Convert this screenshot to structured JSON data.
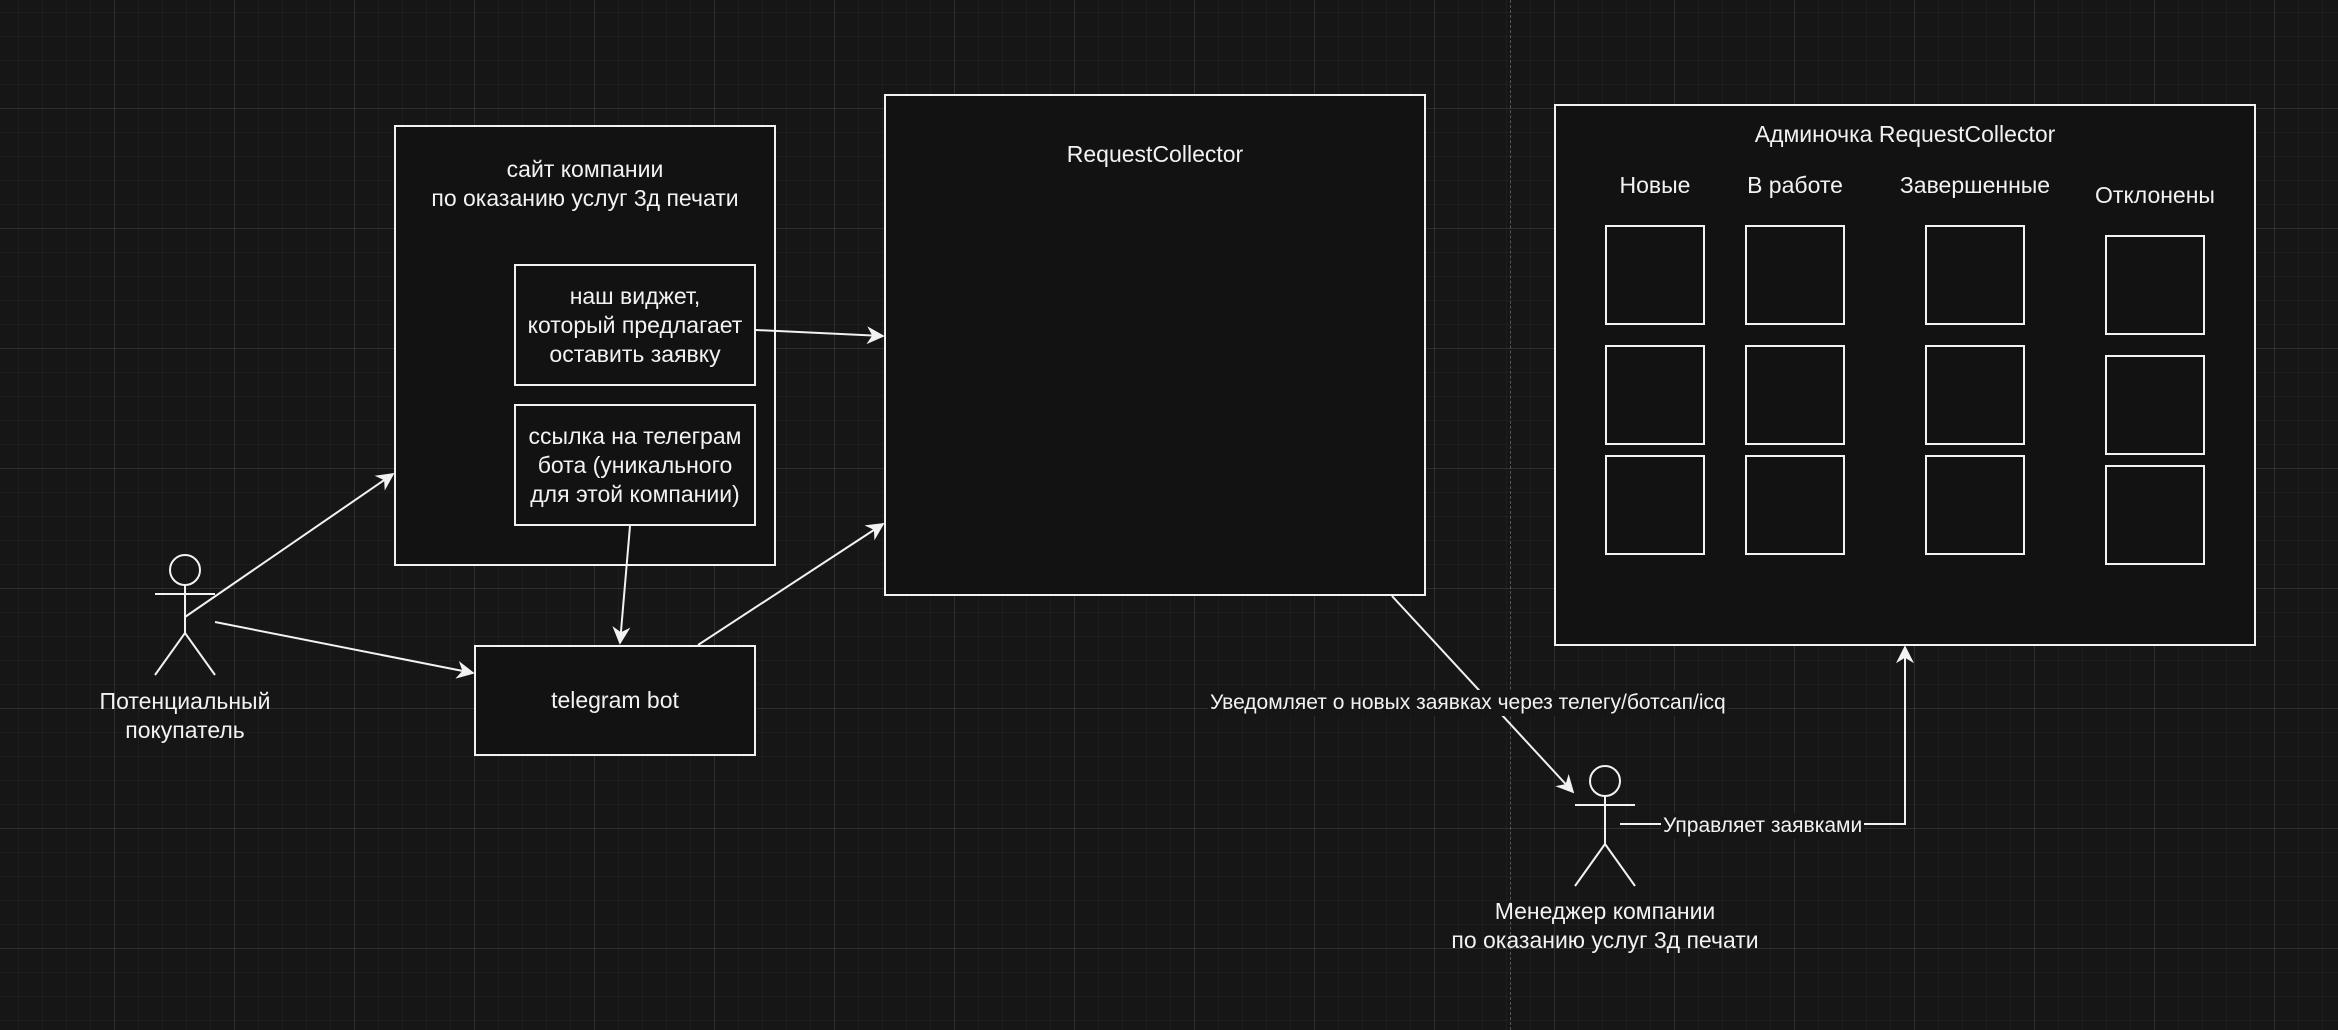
{
  "site": {
    "title": "сайт компании\nпо оказанию услуг 3д печати",
    "widget": "наш виджет,\nкоторый предлагает\nоставить заявку",
    "telegram_link": "ссылка на телеграм\nбота (уникального\nдля этой компании)"
  },
  "telegram_bot": {
    "label": "telegram bot"
  },
  "request_collector": {
    "title": "RequestCollector"
  },
  "admin": {
    "title": "Админочка RequestCollector",
    "columns": [
      {
        "label": "Новые",
        "cards": 3
      },
      {
        "label": "В работе",
        "cards": 3
      },
      {
        "label": "Завершенные",
        "cards": 3
      },
      {
        "label": "Отклонены",
        "cards": 3
      }
    ]
  },
  "actors": {
    "buyer": "Потенциальный\nпокупатель",
    "manager": "Менеджер компании\nпо оказанию услуг 3д печати"
  },
  "edges": {
    "notify": "Уведомляет о новых заявках через телегу/ботсап/icq",
    "manage": "Управляет заявками"
  },
  "colors": {
    "stroke": "#f2f2f2",
    "background": "#161616",
    "fill": "#121212"
  }
}
